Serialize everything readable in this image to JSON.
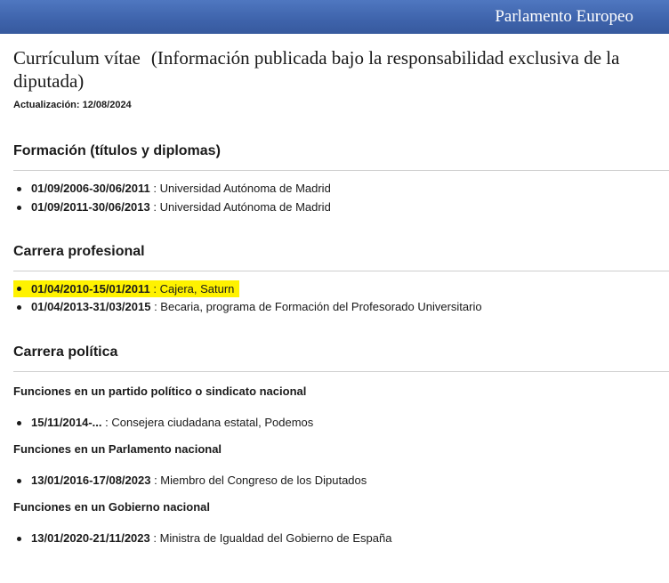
{
  "header": {
    "brand": "Parlamento Europeo"
  },
  "cv": {
    "title": "Currículum vítae",
    "title_note": "(Información publicada bajo la responsabilidad exclusiva de la diputada)",
    "updated": "Actualización: 12/08/2024"
  },
  "education": {
    "heading": "Formación (títulos y diplomas)",
    "items": [
      {
        "date": "01/09/2006-30/06/2011",
        "text": " : Universidad Autónoma de Madrid"
      },
      {
        "date": "01/09/2011-30/06/2013",
        "text": " : Universidad Autónoma de Madrid"
      }
    ]
  },
  "career": {
    "heading": "Carrera profesional",
    "items": [
      {
        "date": "01/04/2010-15/01/2011",
        "text": " : Cajera, Saturn",
        "highlighted": true
      },
      {
        "date": "01/04/2013-31/03/2015",
        "text": " : Becaria, programa de Formación del Profesorado Universitario",
        "highlighted": false
      }
    ],
    "highlight_color": "#fff200"
  },
  "political": {
    "heading": "Carrera política",
    "groups": [
      {
        "title": "Funciones en un partido político o sindicato nacional",
        "items": [
          {
            "date": "15/11/2014-...",
            "text": " : Consejera ciudadana estatal, Podemos"
          }
        ]
      },
      {
        "title": "Funciones en un Parlamento nacional",
        "items": [
          {
            "date": "13/01/2016-17/08/2023",
            "text": " : Miembro del Congreso de los Diputados"
          }
        ]
      },
      {
        "title": "Funciones en un Gobierno nacional",
        "items": [
          {
            "date": "13/01/2020-21/11/2023",
            "text": " : Ministra de Igualdad del Gobierno de España"
          }
        ]
      }
    ]
  },
  "colors": {
    "header_blue": "#3e63ab",
    "highlight": "#fff200"
  }
}
